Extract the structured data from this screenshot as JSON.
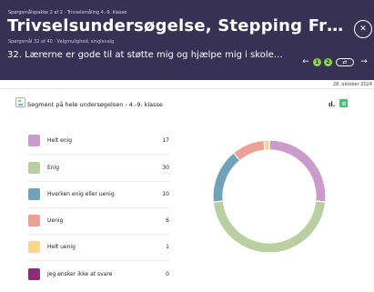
{
  "header": {
    "breadcrumb": "Spørgsmålspakke 2 af 2 · Trivselsmåling 4.-9. klasse",
    "title": "Trivselsundersøgelse, Stepping Fr…",
    "question_meta": "Spørgsmål 32 af 40 · Valgmulighed, singlevalg",
    "question": "32. Lærerne er gode til at støtte mig og hjælpe mig i skole…",
    "nav_dot_1": "1",
    "nav_dot_2": "2",
    "toggle_glyph": "⇄",
    "prev_icon": "←",
    "next_icon": "→",
    "close_icon": "✕"
  },
  "date": "28. oktober 2024",
  "segment": {
    "label": "Segment på hele undersøgelsen  - 4.-9. klasse",
    "chart_icon": "ıl."
  },
  "colors": {
    "header_bg": "#373254",
    "accent_green": "#8fd44e"
  },
  "chart_data": {
    "type": "pie",
    "categories": [
      "Helt enig",
      "Enig",
      "Hverken enig eller uenig",
      "Uenig",
      "Helt uenig",
      "Jeg ønsker ikke at svare"
    ],
    "values": [
      17,
      30,
      10,
      6,
      1,
      0
    ],
    "colors": [
      "#c99ccc",
      "#b9cfa1",
      "#6ea3b9",
      "#ee9f96",
      "#fbd58e",
      "#8e2a7a"
    ]
  }
}
